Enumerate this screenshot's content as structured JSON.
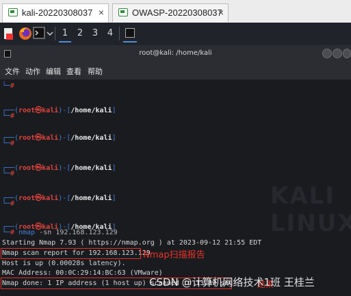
{
  "vm_tabs": [
    {
      "label": "kali-20220308037",
      "close": "×"
    },
    {
      "label": "OWASP-20220308037",
      "close": "×"
    }
  ],
  "panel": {
    "workspaces": [
      "1",
      "2",
      "3",
      "4"
    ]
  },
  "window": {
    "title": "root@kali: /home/kali"
  },
  "menu": [
    "文件",
    "动作",
    "编辑",
    "查看",
    "帮助"
  ],
  "prompt": {
    "user": "root",
    "at": "㉿",
    "host": "kali",
    "path": "/home/kali",
    "symbol": "#"
  },
  "command": {
    "name": "nmap",
    "args": "-sn 192.168.123.129"
  },
  "output": [
    "Starting Nmap 7.93 ( https://nmap.org ) at 2023-09-12 21:55 EDT",
    "Nmap scan report for 192.168.123.129",
    "Host is up (0.00028s latency).",
    "MAC Address: 00:0C:29:14:BC:63 (VMware)",
    "Nmap done: 1 IP address (1 host up) scanned in 13.09 sec"
  ],
  "annotations": {
    "report": "Nmap扫描报告",
    "result": "结果"
  },
  "watermark": "CSDN @计算机网络技术1班 王桂兰",
  "bg_text": "KALI LINUX",
  "colors": {
    "prompt_blue": "#3d7fd8",
    "prompt_red": "#e0443c",
    "highlight": "#e1312a"
  }
}
